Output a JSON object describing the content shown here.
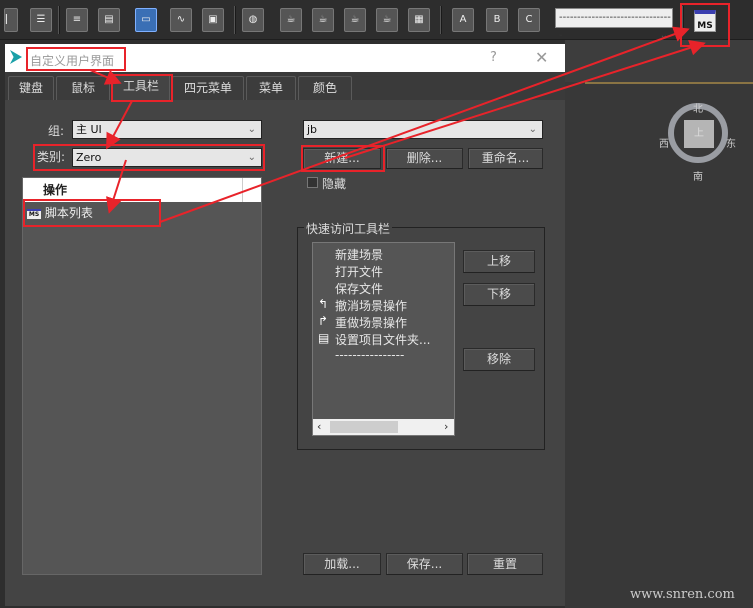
{
  "toolbar": {
    "icons": [
      "snap-toggle-icon",
      "align-icon",
      "layer-list-icon",
      "layer-explorer-icon",
      "toggle-scene-explorer-icon",
      "curve-editor-icon",
      "schematic-view-icon",
      "material-editor-icon",
      "render-setup-icon",
      "rendered-frame-icon",
      "render-icon",
      "render-iterative-icon",
      "render-in-cloud-icon",
      "render-frame-window-icon"
    ],
    "render_presets": [
      {
        "letter": "A"
      },
      {
        "letter": "B"
      },
      {
        "letter": "C"
      }
    ],
    "preset_combo_value": "--------------------------------",
    "ms_button_label": "MS"
  },
  "viewcube": {
    "face": "上",
    "north": "北",
    "south": "南",
    "east": "东",
    "west": "西"
  },
  "dialog": {
    "title": "自定义用户界面",
    "help": "?",
    "close": "✕",
    "tabs": [
      {
        "label": "键盘"
      },
      {
        "label": "鼠标"
      },
      {
        "label": "工具栏",
        "selected": true
      },
      {
        "label": "四元菜单"
      },
      {
        "label": "菜单"
      },
      {
        "label": "颜色"
      }
    ],
    "group_label": "组:",
    "group_value": "主 UI",
    "category_label": "类别:",
    "category_value": "Zero",
    "actions_header": "操作",
    "actions": [
      {
        "icon": "ms-script-icon",
        "icon_text": "MS",
        "label": "脚本列表"
      }
    ],
    "toolbar_combo_value": "jb",
    "new_button": "新建...",
    "delete_button": "删除...",
    "rename_button": "重命名...",
    "hide_label": "隐藏",
    "hide_checked": false,
    "quick_access": {
      "title": "快速访问工具栏",
      "items": [
        {
          "label": "新建场景",
          "icon": ""
        },
        {
          "label": "打开文件",
          "icon": ""
        },
        {
          "label": "保存文件",
          "icon": ""
        },
        {
          "label": "撤消场景操作",
          "icon": "undo-icon"
        },
        {
          "label": "重做场景操作",
          "icon": "redo-icon"
        },
        {
          "label": "设置项目文件夹...",
          "icon": "project-folder-icon"
        },
        {
          "label": "----------------",
          "icon": ""
        }
      ],
      "up_button": "上移",
      "down_button": "下移",
      "remove_button": "移除"
    },
    "load_button": "加载...",
    "save_button": "保存...",
    "reset_button": "重置"
  },
  "watermark": "www.snren.com",
  "annotation_color": "#e8232a"
}
